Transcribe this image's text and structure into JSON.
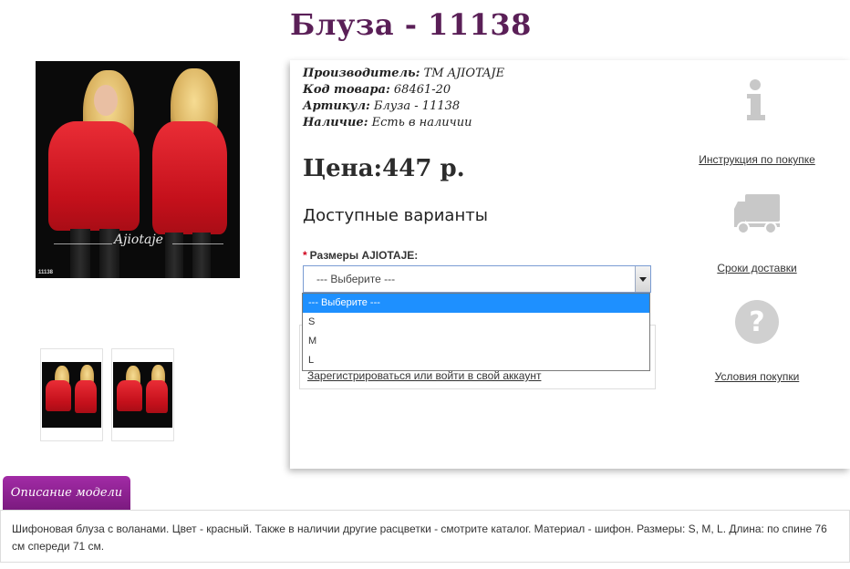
{
  "product": {
    "title": "Блуза - 11138",
    "photo_code": "11138",
    "signature": "Ajiotaje"
  },
  "meta": [
    {
      "label": "Производитель:",
      "value": "ТМ AJIOTAJE"
    },
    {
      "label": "Код товара:",
      "value": "68461-20"
    },
    {
      "label": "Артикул:",
      "value": "Блуза - 11138"
    },
    {
      "label": "Наличие:",
      "value": "Есть в наличии"
    }
  ],
  "price": "Цена:447 р.",
  "variants": {
    "heading": "Доступные варианты",
    "size_label": "Размеры AJIOTAJE:",
    "required_mark": "*",
    "selected": "--- Выберите ---",
    "options": [
      "--- Выберите ---",
      "S",
      "M",
      "L"
    ]
  },
  "login_link": "Зарегистрироваться или войти в свой аккаунт",
  "side": {
    "instruction_link": "Инструкция по покупке",
    "delivery_link": "Сроки доставки",
    "terms_link": "Условия покупки"
  },
  "description": {
    "tab_label": "Описание модели",
    "text": "Шифоновая блуза с воланами. Цвет - красный. Также в наличии другие расцветки - смотрите каталог. Материал - шифон. Размеры: S, M, L. Длина: по спине 76 см спереди 71 см."
  },
  "colors": {
    "title": "#5a1f57",
    "tab": "#8e2192",
    "select_highlight": "#1e90ff",
    "icon_gray": "#c8c8c8"
  }
}
